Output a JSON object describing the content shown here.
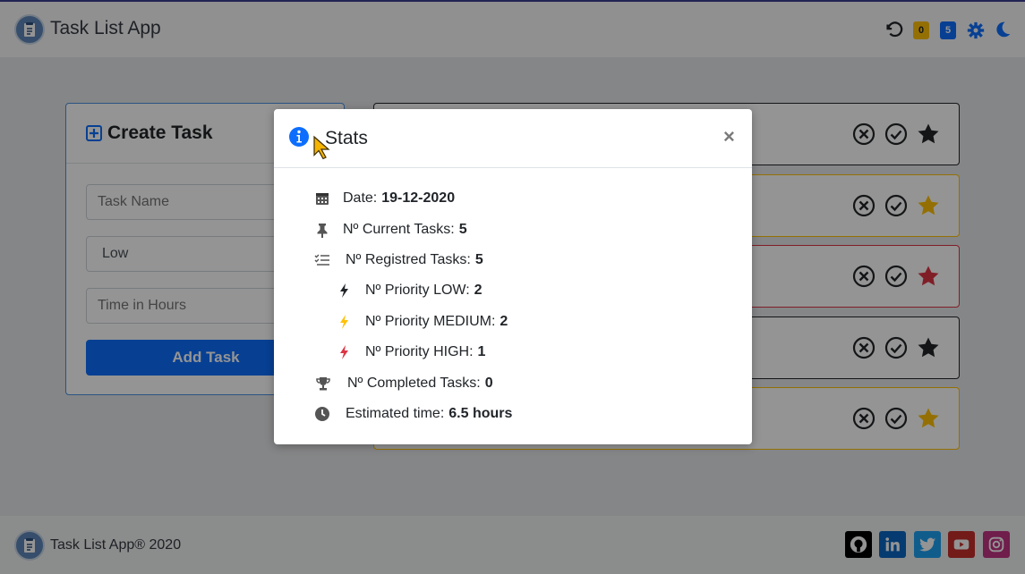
{
  "header": {
    "title": "Task List App",
    "icons": [
      "undo-icon",
      "gear-icon",
      "moon-icon"
    ],
    "badge_low": "0",
    "badge_count": "5"
  },
  "create_task": {
    "title": "Create Task",
    "name_placeholder": "Task Name",
    "priority_value": "Low",
    "time_placeholder": "Time in Hours",
    "add_button": "Add Task"
  },
  "tasks": [
    {
      "priority": "low",
      "star_color": "#212529"
    },
    {
      "priority": "medium",
      "star_color": "#ffc107"
    },
    {
      "priority": "high",
      "star_color": "#dc3545"
    },
    {
      "priority": "low",
      "star_color": "#212529"
    },
    {
      "priority": "medium",
      "star_color": "#ffc107"
    }
  ],
  "modal": {
    "title": "Stats",
    "close": "×",
    "stats": {
      "date_label": "Date:",
      "date_value": "19-12-2020",
      "current_label": "Nº Current Tasks:",
      "current_value": "5",
      "registered_label": "Nº Registred Tasks:",
      "registered_value": "5",
      "low_label": "Nº Priority LOW:",
      "low_value": "2",
      "medium_label": "Nº Priority MEDIUM:",
      "medium_value": "2",
      "high_label": "Nº Priority HIGH:",
      "high_value": "1",
      "completed_label": "Nº Completed Tasks:",
      "completed_value": "0",
      "estimated_label": "Estimated time:",
      "estimated_value": "6.5 hours"
    }
  },
  "footer": {
    "text": "Task List App® 2020",
    "social": [
      "github-icon",
      "linkedin-icon",
      "twitter-icon",
      "youtube-icon",
      "instagram-icon"
    ]
  },
  "colors": {
    "primary": "#0d6efd",
    "low": "#212529",
    "medium": "#ffc107",
    "high": "#dc3545"
  }
}
